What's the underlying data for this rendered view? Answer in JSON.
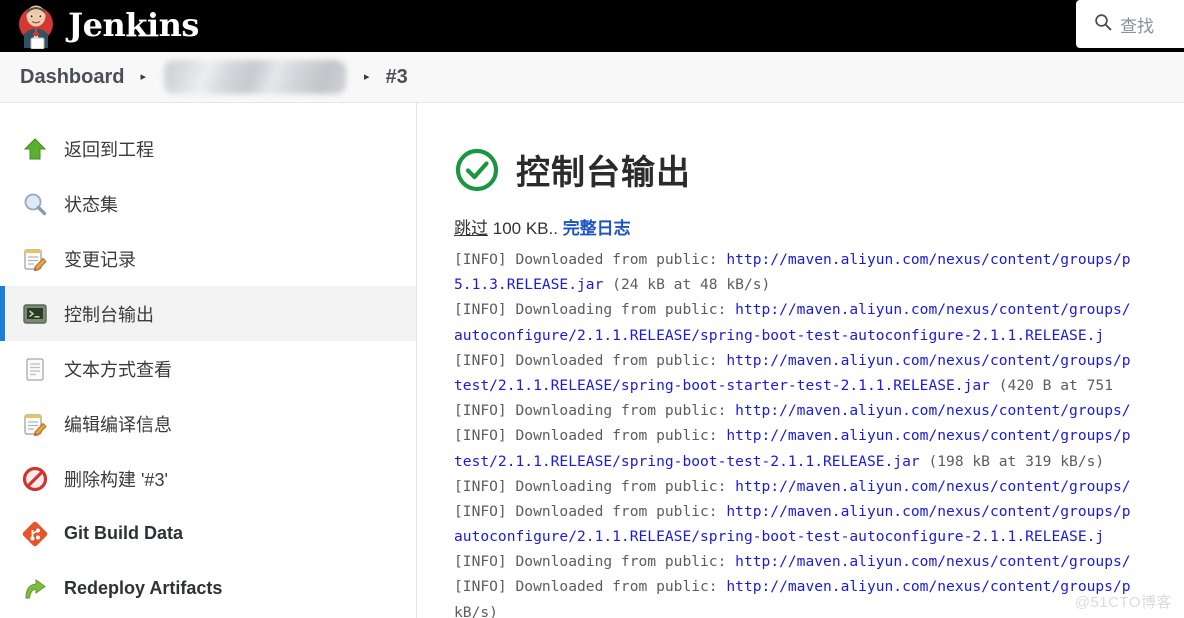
{
  "header": {
    "brand_title": "Jenkins",
    "logo_icon": "jenkins-butler-icon",
    "search_icon": "search-icon",
    "search_placeholder": "查找"
  },
  "breadcrumb": {
    "items": [
      {
        "label": "Dashboard",
        "type": "link"
      },
      {
        "label": "",
        "type": "redacted"
      },
      {
        "label": "#3",
        "type": "link"
      }
    ],
    "separator": "▸"
  },
  "sidebar": {
    "items": [
      {
        "label": "返回到工程",
        "icon": "up-arrow-icon",
        "active": false,
        "latin": false
      },
      {
        "label": "状态集",
        "icon": "magnifier-icon",
        "active": false,
        "latin": false
      },
      {
        "label": "变更记录",
        "icon": "notepad-pencil-icon",
        "active": false,
        "latin": false
      },
      {
        "label": "控制台输出",
        "icon": "terminal-icon",
        "active": true,
        "latin": false
      },
      {
        "label": "文本方式查看",
        "icon": "document-icon",
        "active": false,
        "latin": false
      },
      {
        "label": "编辑编译信息",
        "icon": "notepad-pencil-icon",
        "active": false,
        "latin": false
      },
      {
        "label": "删除构建 '#3'",
        "icon": "no-entry-icon",
        "active": false,
        "latin": false
      },
      {
        "label": "Git Build Data",
        "icon": "git-icon",
        "active": false,
        "latin": true
      },
      {
        "label": "Redeploy Artifacts",
        "icon": "redeploy-arrow-icon",
        "active": false,
        "latin": true
      }
    ]
  },
  "main": {
    "status_icon": "success-check-circle-icon",
    "status_color": "#1a9641",
    "title": "控制台输出",
    "skip_label": "跳过",
    "skip_size": "100 KB..",
    "full_log_label": "完整日志",
    "log_lines": [
      [
        {
          "t": "[INFO] Downloaded from public: ",
          "c": "d"
        },
        {
          "t": "http://maven.aliyun.com/nexus/content/groups/p",
          "c": "u"
        }
      ],
      [
        {
          "t": "5.1.3.RELEASE.jar",
          "c": "u"
        },
        {
          "t": " (24 kB at 48 kB/s)",
          "c": "d"
        }
      ],
      [
        {
          "t": "[INFO] Downloading from public: ",
          "c": "d"
        },
        {
          "t": "http://maven.aliyun.com/nexus/content/groups/",
          "c": "u"
        }
      ],
      [
        {
          "t": "autoconfigure/2.1.1.RELEASE/spring-boot-test-autoconfigure-2.1.1.RELEASE.j",
          "c": "u"
        }
      ],
      [
        {
          "t": "[INFO] Downloaded from public: ",
          "c": "d"
        },
        {
          "t": "http://maven.aliyun.com/nexus/content/groups/p",
          "c": "u"
        }
      ],
      [
        {
          "t": "test/2.1.1.RELEASE/spring-boot-starter-test-2.1.1.RELEASE.jar",
          "c": "u"
        },
        {
          "t": " (420 B at 751",
          "c": "d"
        }
      ],
      [
        {
          "t": "[INFO] Downloading from public: ",
          "c": "d"
        },
        {
          "t": "http://maven.aliyun.com/nexus/content/groups/",
          "c": "u"
        }
      ],
      [
        {
          "t": "[INFO] Downloaded from public: ",
          "c": "d"
        },
        {
          "t": "http://maven.aliyun.com/nexus/content/groups/p",
          "c": "u"
        }
      ],
      [
        {
          "t": "test/2.1.1.RELEASE/spring-boot-test-2.1.1.RELEASE.jar",
          "c": "u"
        },
        {
          "t": " (198 kB at 319 kB/s)",
          "c": "d"
        }
      ],
      [
        {
          "t": "[INFO] Downloading from public: ",
          "c": "d"
        },
        {
          "t": "http://maven.aliyun.com/nexus/content/groups/",
          "c": "u"
        }
      ],
      [
        {
          "t": "[INFO] Downloaded from public: ",
          "c": "d"
        },
        {
          "t": "http://maven.aliyun.com/nexus/content/groups/p",
          "c": "u"
        }
      ],
      [
        {
          "t": "autoconfigure/2.1.1.RELEASE/spring-boot-test-autoconfigure-2.1.1.RELEASE.j",
          "c": "u"
        }
      ],
      [
        {
          "t": "[INFO] Downloading from public: ",
          "c": "d"
        },
        {
          "t": "http://maven.aliyun.com/nexus/content/groups/",
          "c": "u"
        }
      ],
      [
        {
          "t": "[INFO] Downloaded from public: ",
          "c": "d"
        },
        {
          "t": "http://maven.aliyun.com/nexus/content/groups/p",
          "c": "u"
        }
      ],
      [
        {
          "t": "kB/s)",
          "c": "d"
        }
      ]
    ]
  },
  "watermark": {
    "text": "@51CTO博客"
  }
}
